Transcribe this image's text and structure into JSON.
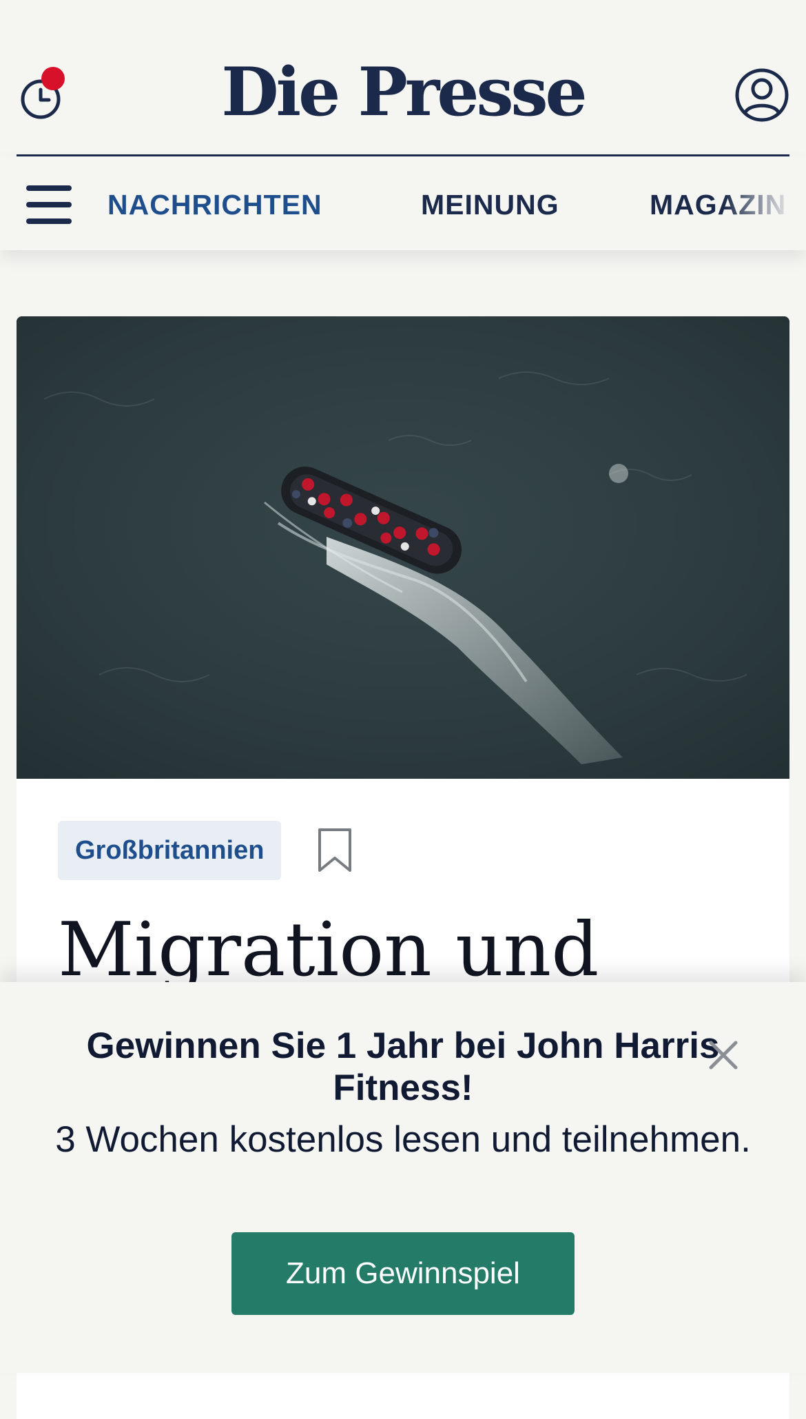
{
  "header": {
    "logo": "Die Presse",
    "history_icon": "clock-history-icon",
    "account_icon": "user-account-icon",
    "notification_color": "#d8112b"
  },
  "nav": {
    "menu_icon": "hamburger-menu-icon",
    "items": [
      {
        "label": "NACHRICHTEN",
        "active": true
      },
      {
        "label": "MEINUNG",
        "active": false
      },
      {
        "label": "MAGAZIN",
        "active": false
      }
    ]
  },
  "article": {
    "image_alt": "Schlauchboot mit Menschen auf offener See, Luftaufnahme",
    "tag": "Großbritannien",
    "bookmark_icon": "bookmark-icon",
    "headline": "Migration und"
  },
  "promo": {
    "title": "Gewinnen Sie 1 Jahr bei John Harris Fitness!",
    "subtitle": "3 Wochen kostenlos lesen und teilnehmen.",
    "cta_label": "Zum Gewinnspiel",
    "close_icon": "close-icon",
    "cta_color": "#247c68"
  },
  "colors": {
    "brand": "#1b2a4a",
    "accent": "#1e4e8c",
    "background": "#f5f5f2"
  }
}
